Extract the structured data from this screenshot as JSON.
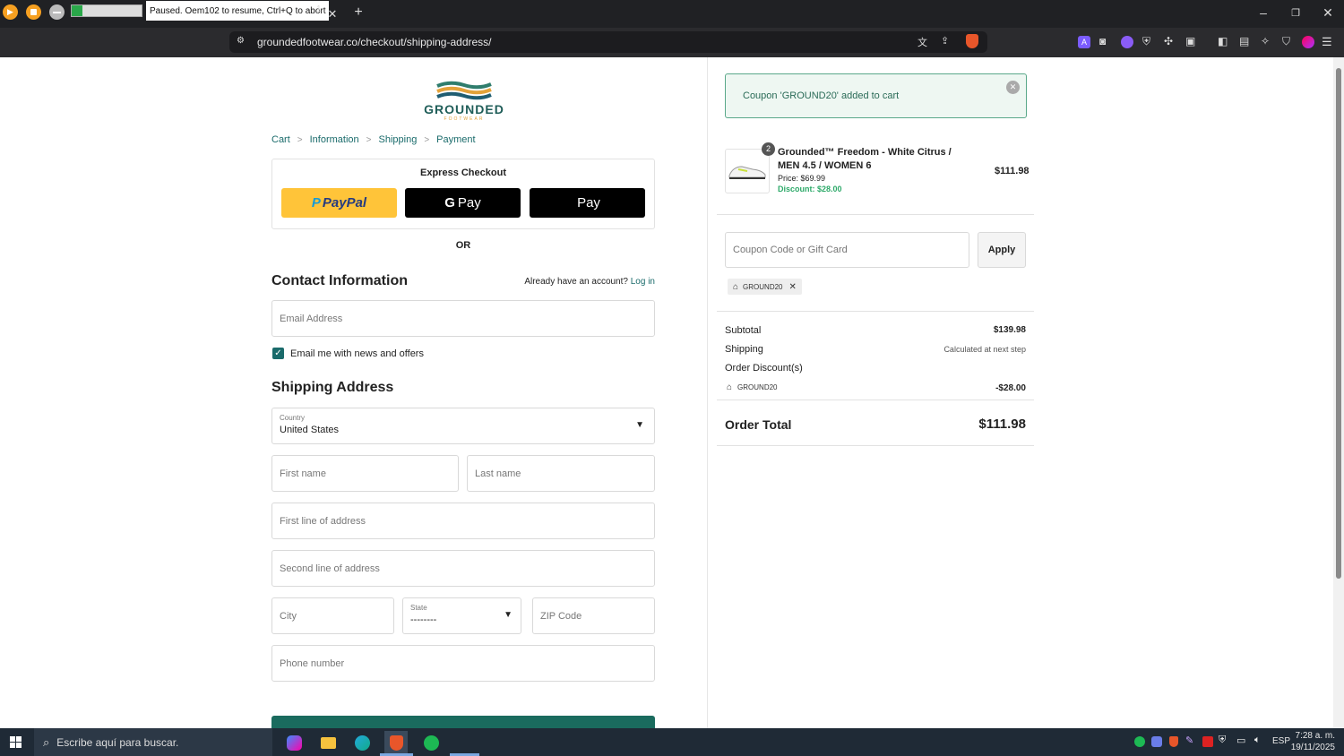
{
  "browser": {
    "tab_title": "Paused. Oem102 to resume, Ctrl+Q to abort",
    "tab_count": "1",
    "url": "groundedfootwear.co/checkout/shipping-address/"
  },
  "brand": {
    "name": "GROUNDED",
    "sub": "FOOTWEAR"
  },
  "breadcrumb": [
    "Cart",
    "Information",
    "Shipping",
    "Payment"
  ],
  "express": {
    "title": "Express Checkout",
    "paypal": "PayPal",
    "gpay": "Pay",
    "applepay": "Pay"
  },
  "or_label": "OR",
  "contact": {
    "heading": "Contact Information",
    "account_prompt": "Already have an account?",
    "login": "Log in",
    "email_placeholder": "Email Address",
    "newsletter_label": "Email me with news and offers",
    "newsletter_checked": true
  },
  "shipping": {
    "heading": "Shipping Address",
    "country_label": "Country",
    "country_value": "United States",
    "first_name": "First name",
    "last_name": "Last name",
    "address1": "First line of address",
    "address2": "Second line of address",
    "city": "City",
    "state_label": "State",
    "state_value": "--------",
    "zip": "ZIP Code",
    "phone": "Phone number"
  },
  "notice": {
    "text": "Coupon 'GROUND20' added to cart"
  },
  "cart_item": {
    "qty": "2",
    "title_line1": "Grounded™ Freedom - White Citrus /",
    "title_line2": "MEN 4.5 / WOMEN 6",
    "price": "Price: $69.99",
    "discount": "Discount: $28.00",
    "total": "$111.98"
  },
  "coupon": {
    "placeholder": "Coupon Code or Gift Card",
    "apply": "Apply",
    "applied_code": "GROUND20"
  },
  "summary": {
    "subtotal_label": "Subtotal",
    "subtotal": "$139.98",
    "shipping_label": "Shipping",
    "shipping": "Calculated at next step",
    "discounts_label": "Order Discount(s)",
    "discount_code": "GROUND20",
    "discount_amount": "-$28.00",
    "total_label": "Order Total",
    "total": "$111.98"
  },
  "taskbar": {
    "search_placeholder": "Escribe aquí para buscar.",
    "lang": "ESP",
    "time": "7:28 a. m.",
    "date": "19/11/2025"
  },
  "colors": {
    "accent": "#1a6b6b",
    "notice_bg": "#eef7f2",
    "notice_border": "#5aa88a",
    "paypal": "#ffc439",
    "discount": "#2eaa6a"
  }
}
